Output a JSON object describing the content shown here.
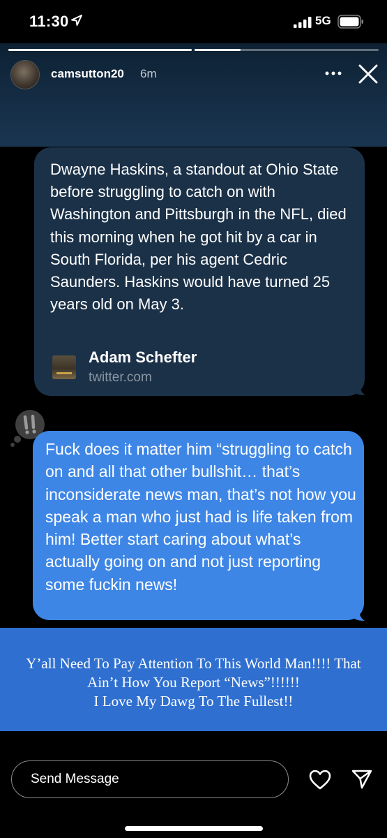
{
  "status_bar": {
    "time": "11:30",
    "network": "5G",
    "location_icon": "location-arrow-icon",
    "signal_icon": "cellular-signal-icon",
    "battery_icon": "battery-icon"
  },
  "story": {
    "username": "camsutton20",
    "time_ago": "6m",
    "progress_segments": [
      1.0,
      0.25
    ],
    "more_icon": "more-dots-icon",
    "close_icon": "close-icon"
  },
  "tweet": {
    "text": "Dwayne Haskins, a standout at Ohio State before struggling to catch on with Washington and Pittsburgh in the NFL, died this morning when he got hit by a car in South Florida, per his agent Cedric Saunders. Haskins would have turned 25 years old on May 3.",
    "author": "Adam Schefter",
    "domain": "twitter.com"
  },
  "reaction": {
    "icon": "double-exclamation-reaction-icon"
  },
  "reply": {
    "text": "Fuck does it matter him “struggling to catch on and all that other bullshit… that’s inconsiderate news man, that’s not how you speak a man who just had is life taken from him! Better start caring about what’s actually going on and not just reporting some fuckin news!"
  },
  "caption": {
    "lines": [
      "Y’all Need To Pay Attention To This World Man!!!! That",
      "Ain’t How You Report “News”!!!!!!",
      "I Love My Dawg To The Fullest!!"
    ]
  },
  "footer": {
    "send_placeholder": "Send Message",
    "heart_icon": "heart-icon",
    "share_icon": "paper-plane-icon"
  },
  "colors": {
    "tweet_bubble": "#1b3148",
    "reply_bubble": "#3e86e6",
    "caption_bg": "#2f6fd0",
    "story_header": "#173049"
  }
}
